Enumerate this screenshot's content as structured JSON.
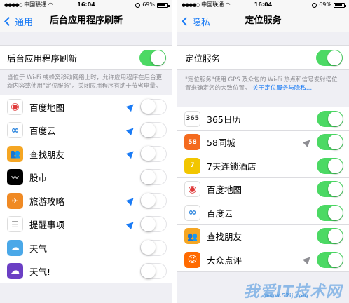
{
  "status_bar": {
    "carrier": "中国联通",
    "time": "16:04",
    "battery": "69%"
  },
  "left": {
    "back_label": "通用",
    "title": "后台应用程序刷新",
    "master_label": "后台应用程序刷新",
    "master_on": true,
    "footer": "当位于 Wi-Fi 或蜂窝移动网络上时，允许应用程序在后台更新内容或使用\"定位服务\"。关闭应用程序有助于节省电量。",
    "apps": [
      {
        "name": "百度地图",
        "icon": "baidu-map-icon",
        "color": "#ffffff",
        "location_arrow": true,
        "on": false
      },
      {
        "name": "百度云",
        "icon": "baidu-cloud-icon",
        "color": "#ffffff",
        "location_arrow": true,
        "on": false
      },
      {
        "name": "查找朋友",
        "icon": "find-friends-icon",
        "color": "#f5a623",
        "location_arrow": true,
        "on": false
      },
      {
        "name": "股市",
        "icon": "stocks-icon",
        "color": "#000000",
        "location_arrow": false,
        "on": false
      },
      {
        "name": "旅游攻略",
        "icon": "travel-guide-icon",
        "color": "#f08a24",
        "location_arrow": true,
        "on": false
      },
      {
        "name": "提醒事项",
        "icon": "reminders-icon",
        "color": "#ffffff",
        "location_arrow": true,
        "on": false
      },
      {
        "name": "天气",
        "icon": "weather-icon",
        "color": "#4aa8e8",
        "location_arrow": false,
        "on": false
      },
      {
        "name": "天气!",
        "icon": "weather2-icon",
        "color": "#6b3fc4",
        "location_arrow": false,
        "on": false
      }
    ]
  },
  "right": {
    "back_label": "隐私",
    "title": "定位服务",
    "master_label": "定位服务",
    "master_on": true,
    "footer_text": "\"定位服务\"使用 GPS 及众包的 Wi-Fi 热点和信号发射塔位置来确定您的大致位置。",
    "footer_link": "关于定位服务与隐私…",
    "apps": [
      {
        "name": "365日历",
        "icon": "calendar365-icon",
        "color": "#ffffff",
        "badge": "365",
        "location_arrow": false,
        "on": true
      },
      {
        "name": "58同城",
        "icon": "58tongcheng-icon",
        "color": "#f46b1f",
        "badge": "58",
        "location_arrow": true,
        "arrow_gray": true,
        "on": true
      },
      {
        "name": "7天连锁酒店",
        "icon": "7days-hotel-icon",
        "color": "#f2c600",
        "badge": "7",
        "location_arrow": false,
        "on": true
      },
      {
        "name": "百度地图",
        "icon": "baidu-map-icon",
        "color": "#ffffff",
        "badge": "",
        "location_arrow": false,
        "on": true
      },
      {
        "name": "百度云",
        "icon": "baidu-cloud-icon",
        "color": "#ffffff",
        "badge": "",
        "location_arrow": false,
        "on": true
      },
      {
        "name": "查找朋友",
        "icon": "find-friends-icon",
        "color": "#f5a623",
        "badge": "",
        "location_arrow": false,
        "on": true
      },
      {
        "name": "大众点评",
        "icon": "dianping-icon",
        "color": "#ff6a00",
        "badge": "",
        "location_arrow": true,
        "arrow_gray": true,
        "on": true
      }
    ]
  },
  "watermark": {
    "text": "我爱IT技术网",
    "url": "www.52ij.com"
  }
}
